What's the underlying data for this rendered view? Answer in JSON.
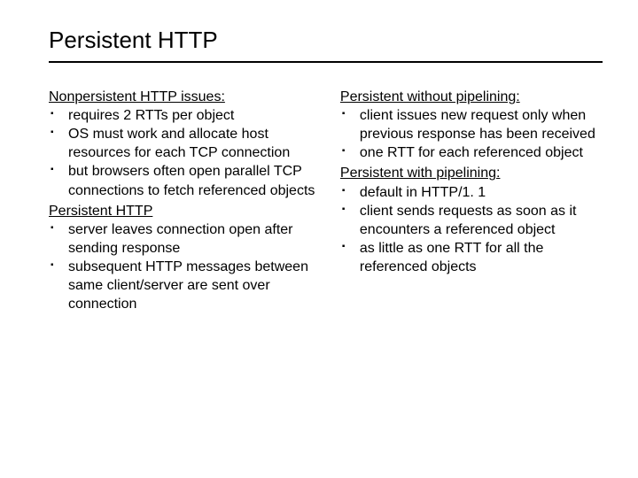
{
  "title": "Persistent HTTP",
  "left": {
    "section1": {
      "heading": "Nonpersistent HTTP issues:",
      "items": [
        "requires 2 RTTs per object",
        "OS must work and allocate host resources for each TCP connection",
        "but browsers often open parallel TCP connections to fetch referenced objects"
      ]
    },
    "section2": {
      "heading": "Persistent  HTTP",
      "items": [
        "server leaves connection open after sending response",
        "subsequent HTTP messages between same client/server are sent over connection"
      ]
    }
  },
  "right": {
    "section1": {
      "heading": "Persistent without pipelining:",
      "items": [
        "client issues new request only when previous response has been received",
        "one RTT for each referenced object"
      ]
    },
    "section2": {
      "heading": "Persistent with pipelining:",
      "items": [
        "default in HTTP/1. 1",
        "client sends requests as soon as it encounters a referenced object",
        "as little as one RTT for all the referenced objects"
      ]
    }
  }
}
